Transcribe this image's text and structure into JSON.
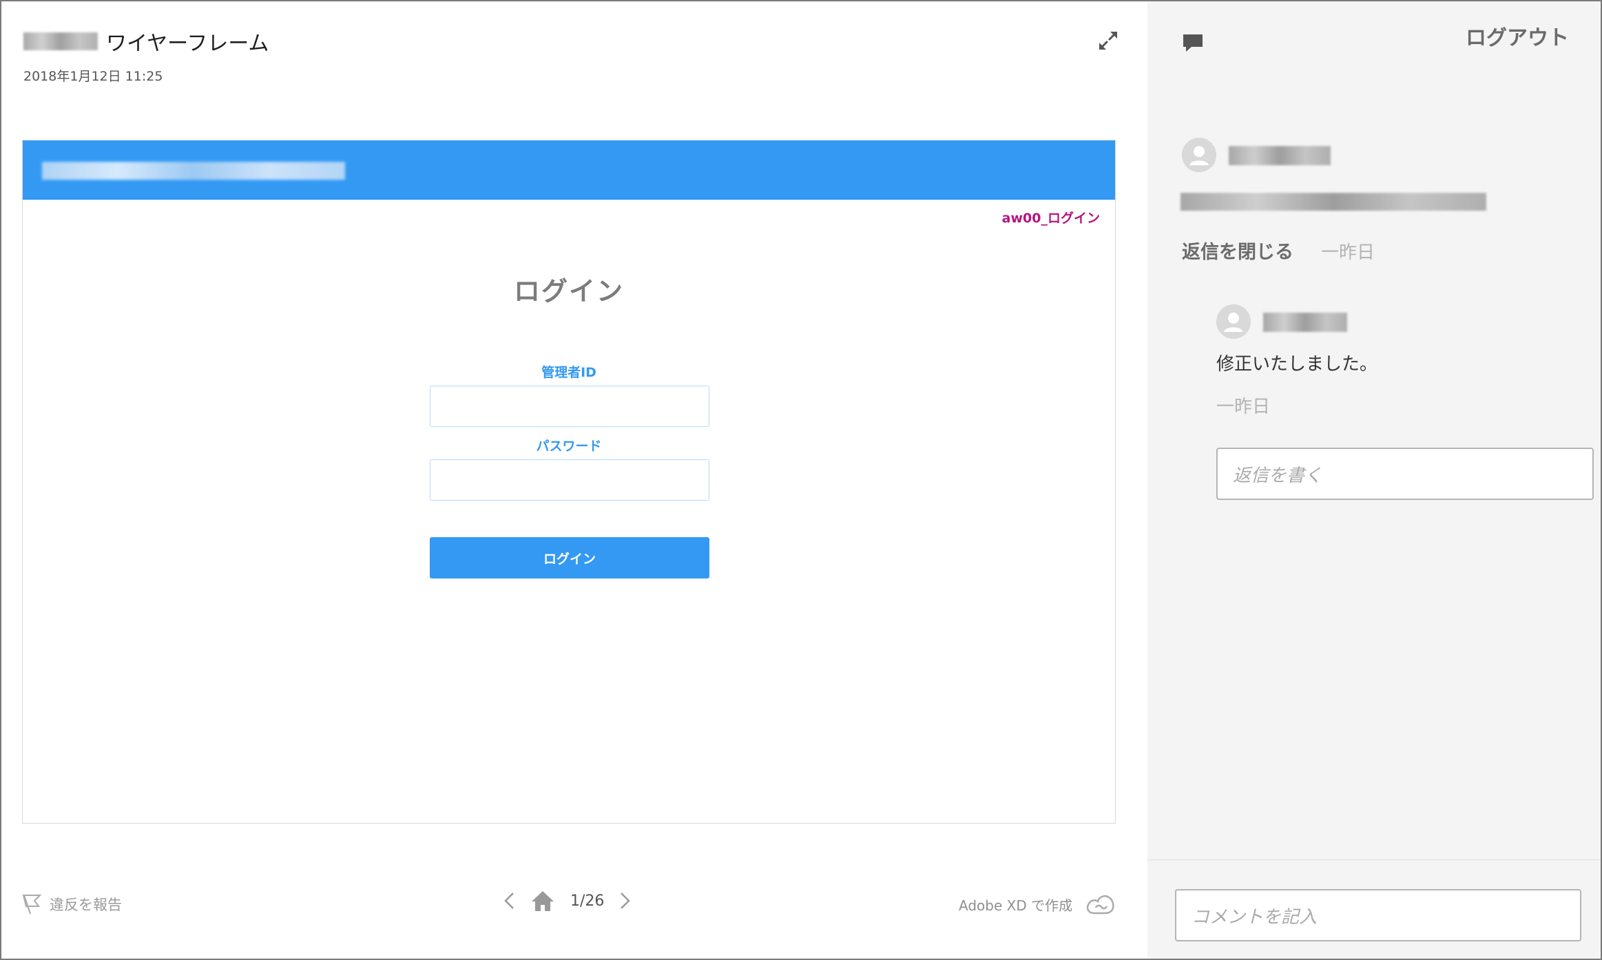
{
  "header": {
    "title": "ワイヤーフレーム",
    "date": "2018年1月12日 11:25"
  },
  "artboard": {
    "name": "aw00_ログイン",
    "heading": "ログイン",
    "id_label": "管理者ID",
    "password_label": "パスワード",
    "login_button": "ログイン",
    "header_color": "#3399f3"
  },
  "footer": {
    "report_label": "違反を報告",
    "page_indicator": "1/26",
    "made_with": "Adobe XD で作成"
  },
  "sidebar": {
    "logout_label": "ログアウト",
    "close_replies_label": "返信を閉じる",
    "comment_time": "一昨日",
    "reply": {
      "text": "修正いたしました。",
      "time": "一昨日"
    },
    "reply_placeholder": "返信を書く",
    "comment_placeholder": "コメントを記入"
  },
  "icons": {
    "expand": "expand-icon",
    "comment": "comment-icon",
    "avatar": "avatar-icon",
    "flag": "flag-icon",
    "prev": "chevron-left-icon",
    "home": "home-icon",
    "next": "chevron-right-icon",
    "creative_cloud": "creative-cloud-icon"
  }
}
